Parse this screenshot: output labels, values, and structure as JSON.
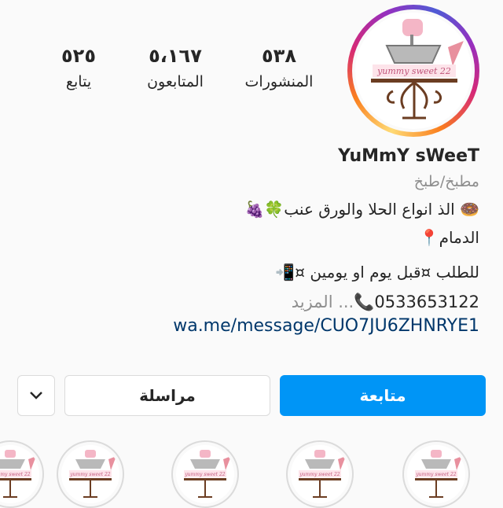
{
  "profile": {
    "logo_text": "yummy sweet 22",
    "posts": {
      "count": "٥٣٨",
      "label": "المنشورات"
    },
    "followers": {
      "count": "٥،١٦٧",
      "label": "المتابعون"
    },
    "following": {
      "count": "٥٢٥",
      "label": "يتابع"
    },
    "name": "YuMmY sWeeT",
    "category": "مطبخ/طبخ",
    "bio": [
      "🍩 الذ انواع الحلا والورق عنب🍀🍇",
      "الدمام📍",
      "للطلب ¤قبل يوم او يومين ¤📲"
    ],
    "phone": "0533653122📞",
    "more_label": "... المزيد",
    "link": "wa.me/message/CUO7JU6ZHNRYE1"
  },
  "actions": {
    "follow_label": "متابعة",
    "message_label": "مراسلة",
    "dropdown_icon": "chevron-down-icon"
  },
  "highlights": {
    "count_visible": 5,
    "logo_text": "yummy sweet 22"
  },
  "colors": {
    "follow_button": "#0095f6",
    "link": "#00376b",
    "muted_text": "#8e8e8e"
  }
}
